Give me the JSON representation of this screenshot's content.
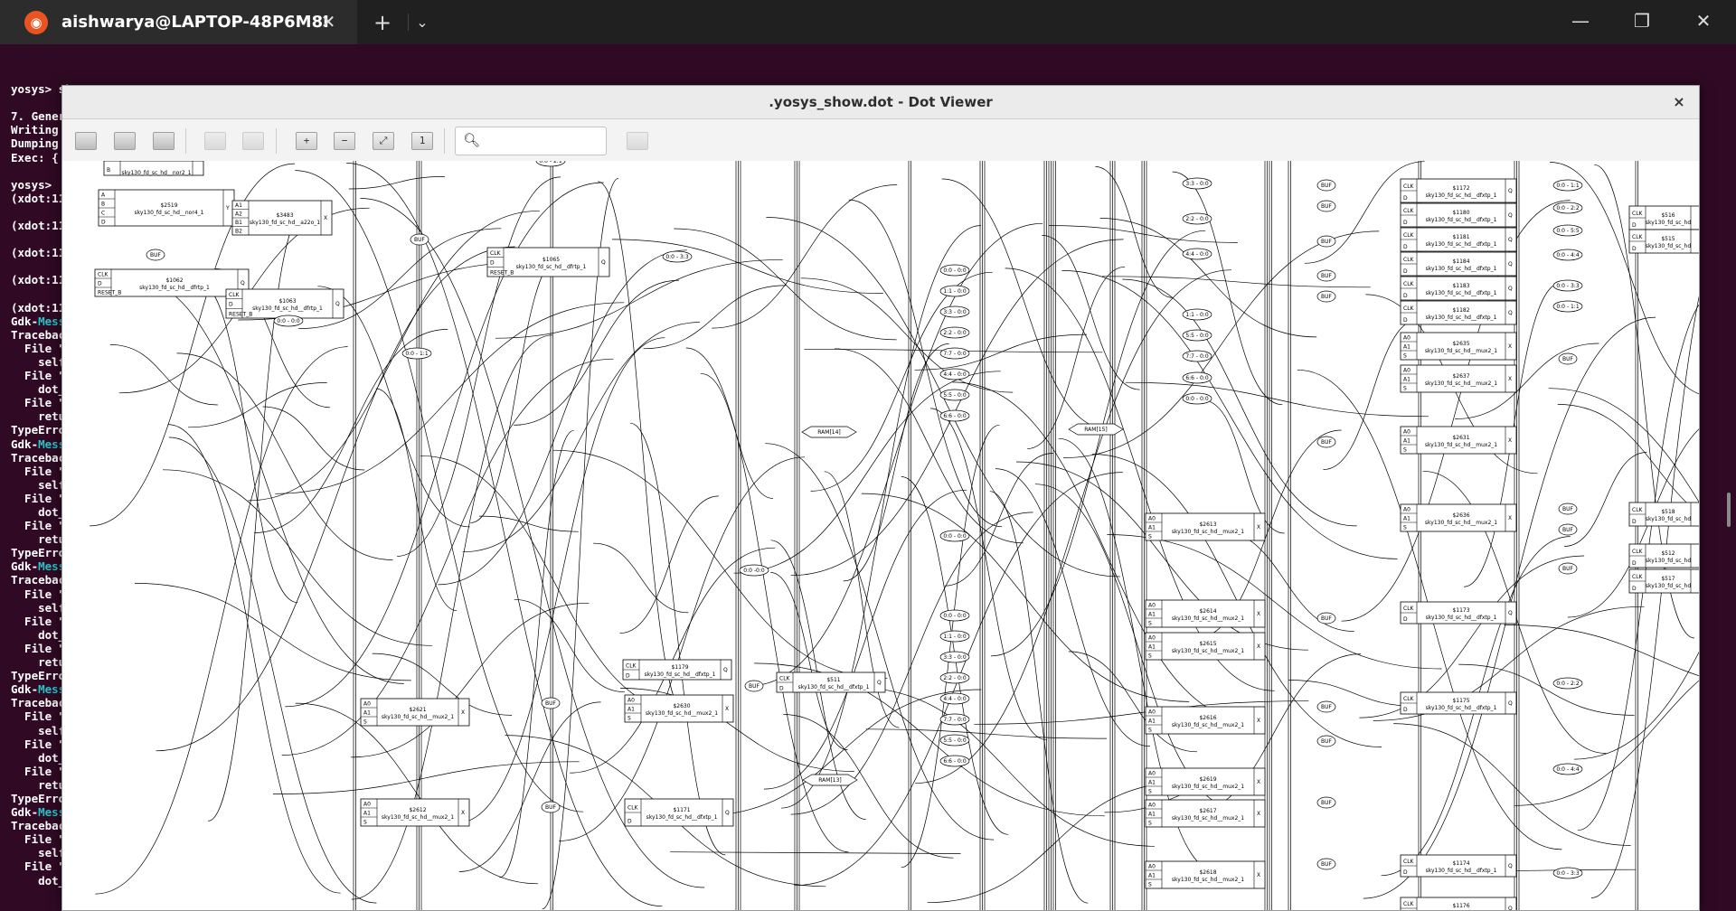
{
  "terminal_tab": {
    "title": "aishwarya@LAPTOP-48P6M8I",
    "icon": "ubuntu-icon",
    "close_glyph": "✕",
    "new_tab_glyph": "+",
    "menu_glyph": "⌄"
  },
  "window_controls": {
    "minimize": "—",
    "maximize": "❐",
    "close": "✕"
  },
  "terminal_lines": [
    {
      "text": "",
      "gdk": ""
    },
    {
      "text": "yosys> show",
      "gdk": ""
    },
    {
      "text": "",
      "gdk": ""
    },
    {
      "text": "7. Gener",
      "gdk": ""
    },
    {
      "text": "Writing ",
      "gdk": ""
    },
    {
      "text": "Dumping ",
      "gdk": ""
    },
    {
      "text": "Exec: {",
      "gdk": ""
    },
    {
      "text": "",
      "gdk": ""
    },
    {
      "text": "yosys>",
      "gdk": ""
    },
    {
      "text": "(xdot:11",
      "gdk": ""
    },
    {
      "text": "",
      "gdk": ""
    },
    {
      "text": "(xdot:11",
      "gdk": ""
    },
    {
      "text": "",
      "gdk": ""
    },
    {
      "text": "(xdot:11",
      "gdk": ""
    },
    {
      "text": "",
      "gdk": ""
    },
    {
      "text": "(xdot:11",
      "gdk": ""
    },
    {
      "text": "",
      "gdk": ""
    },
    {
      "text": "(xdot:11",
      "gdk": ""
    },
    {
      "text": "Gdk-",
      "gdk": "Mess"
    },
    {
      "text": "Tracebac",
      "gdk": ""
    },
    {
      "text": "  File \"",
      "gdk": ""
    },
    {
      "text": "    self",
      "gdk": ""
    },
    {
      "text": "  File \"",
      "gdk": ""
    },
    {
      "text": "    dot_",
      "gdk": ""
    },
    {
      "text": "  File \"",
      "gdk": ""
    },
    {
      "text": "    retu",
      "gdk": ""
    },
    {
      "text": "TypeErro",
      "gdk": ""
    },
    {
      "text": "Gdk-",
      "gdk": "Mess"
    },
    {
      "text": "Tracebac",
      "gdk": ""
    },
    {
      "text": "  File \"",
      "gdk": ""
    },
    {
      "text": "    self",
      "gdk": ""
    },
    {
      "text": "  File \"",
      "gdk": ""
    },
    {
      "text": "    dot_",
      "gdk": ""
    },
    {
      "text": "  File \"",
      "gdk": ""
    },
    {
      "text": "    retu",
      "gdk": ""
    },
    {
      "text": "TypeErro",
      "gdk": ""
    },
    {
      "text": "Gdk-",
      "gdk": "Mess"
    },
    {
      "text": "Tracebac",
      "gdk": ""
    },
    {
      "text": "  File \"",
      "gdk": ""
    },
    {
      "text": "    self",
      "gdk": ""
    },
    {
      "text": "  File \"",
      "gdk": ""
    },
    {
      "text": "    dot_",
      "gdk": ""
    },
    {
      "text": "  File \"",
      "gdk": ""
    },
    {
      "text": "    retu",
      "gdk": ""
    },
    {
      "text": "TypeErro",
      "gdk": ""
    },
    {
      "text": "Gdk-",
      "gdk": "Mess"
    },
    {
      "text": "Tracebac",
      "gdk": ""
    },
    {
      "text": "  File \"",
      "gdk": ""
    },
    {
      "text": "    self",
      "gdk": ""
    },
    {
      "text": "  File \"",
      "gdk": ""
    },
    {
      "text": "    dot_",
      "gdk": ""
    },
    {
      "text": "  File \"",
      "gdk": ""
    },
    {
      "text": "    retu",
      "gdk": ""
    },
    {
      "text": "TypeErro",
      "gdk": ""
    },
    {
      "text": "Gdk-",
      "gdk": "Mess"
    },
    {
      "text": "Tracebac",
      "gdk": ""
    },
    {
      "text": "  File \"",
      "gdk": ""
    },
    {
      "text": "    self",
      "gdk": ""
    },
    {
      "text": "  File \"",
      "gdk": ""
    },
    {
      "text": "    dot_",
      "gdk": ""
    }
  ],
  "viewer": {
    "title": ".yosys_show.dot - Dot Viewer",
    "close_glyph": "×",
    "search_icon": "search-icon",
    "search_value": ""
  },
  "graph": {
    "colors": {
      "edge": "#000000",
      "node_fill": "#ffffff"
    },
    "cells": [
      {
        "name": "cell-nor2",
        "ports_in": [
          "B"
        ],
        "id": "",
        "type": "sky130_fd_sc_hd__nor2_1",
        "out": ""
      },
      {
        "name": "cell-2519",
        "ports_in": [
          "A",
          "B",
          "C",
          "D"
        ],
        "id": "$2519",
        "type": "sky130_fd_sc_hd__nor4_1",
        "out": "Y"
      },
      {
        "name": "cell-3483",
        "ports_in": [
          "A1",
          "A2",
          "B1",
          "B2"
        ],
        "id": "$3483",
        "type": "sky130_fd_sc_hd__a22o_1",
        "out": "X"
      },
      {
        "name": "cell-1062",
        "ports_in": [
          "CLK",
          "D",
          "RESET_B"
        ],
        "id": "$1062",
        "type": "sky130_fd_sc_hd__dfrtp_1",
        "out": "Q"
      },
      {
        "name": "cell-1063",
        "ports_in": [
          "CLK",
          "D",
          "RESET_B"
        ],
        "id": "$1063",
        "type": "sky130_fd_sc_hd__dfrtp_1",
        "out": "Q"
      },
      {
        "name": "cell-1065",
        "ports_in": [
          "CLK",
          "D",
          "RESET_B"
        ],
        "id": "$1065",
        "type": "sky130_fd_sc_hd__dfrtp_1",
        "out": "Q"
      },
      {
        "name": "cell-1179",
        "ports_in": [
          "CLK",
          "D"
        ],
        "id": "$1179",
        "type": "sky130_fd_sc_hd__dfxtp_1",
        "out": "Q"
      },
      {
        "name": "cell-511",
        "ports_in": [
          "CLK",
          "D"
        ],
        "id": "$511",
        "type": "sky130_fd_sc_hd__dfxtp_1",
        "out": "Q"
      },
      {
        "name": "cell-2621",
        "ports_in": [
          "A0",
          "A1",
          "S"
        ],
        "id": "$2621",
        "type": "sky130_fd_sc_hd__mux2_1",
        "out": "X"
      },
      {
        "name": "cell-2630",
        "ports_in": [
          "A0",
          "A1",
          "S"
        ],
        "id": "$2630",
        "type": "sky130_fd_sc_hd__mux2_1",
        "out": "X"
      },
      {
        "name": "cell-2612",
        "ports_in": [
          "A0",
          "A1",
          "S"
        ],
        "id": "$2612",
        "type": "sky130_fd_sc_hd__mux2_1",
        "out": "X"
      },
      {
        "name": "cell-1171",
        "ports_in": [
          "CLK",
          "D"
        ],
        "id": "$1171",
        "type": "sky130_fd_sc_hd__dfxtp_1",
        "out": "Q"
      },
      {
        "name": "cell-2613",
        "ports_in": [
          "A0",
          "A1",
          "S"
        ],
        "id": "$2613",
        "type": "sky130_fd_sc_hd__mux2_1",
        "out": "X"
      },
      {
        "name": "cell-2614",
        "ports_in": [
          "A0",
          "A1",
          "S"
        ],
        "id": "$2614",
        "type": "sky130_fd_sc_hd__mux2_1",
        "out": "X"
      },
      {
        "name": "cell-2615",
        "ports_in": [
          "A0",
          "A1",
          "S"
        ],
        "id": "$2615",
        "type": "sky130_fd_sc_hd__mux2_1",
        "out": "X"
      },
      {
        "name": "cell-2616",
        "ports_in": [
          "A0",
          "A1",
          "S"
        ],
        "id": "$2616",
        "type": "sky130_fd_sc_hd__mux2_1",
        "out": "X"
      },
      {
        "name": "cell-2619",
        "ports_in": [
          "A0",
          "A1",
          "S"
        ],
        "id": "$2619",
        "type": "sky130_fd_sc_hd__mux2_1",
        "out": "X"
      },
      {
        "name": "cell-2617",
        "ports_in": [
          "A0",
          "A1",
          "S"
        ],
        "id": "$2617",
        "type": "sky130_fd_sc_hd__mux2_1",
        "out": "X"
      },
      {
        "name": "cell-2618",
        "ports_in": [
          "A0",
          "A1",
          "S"
        ],
        "id": "$2618",
        "type": "sky130_fd_sc_hd__mux2_1",
        "out": "X"
      },
      {
        "name": "cell-1172",
        "ports_in": [
          "CLK",
          "D"
        ],
        "id": "$1172",
        "type": "sky130_fd_sc_hd__dfxtp_1",
        "out": "Q"
      },
      {
        "name": "cell-1180",
        "ports_in": [
          "CLK",
          "D"
        ],
        "id": "$1180",
        "type": "sky130_fd_sc_hd__dfxtp_1",
        "out": "Q"
      },
      {
        "name": "cell-1181",
        "ports_in": [
          "CLK",
          "D"
        ],
        "id": "$1181",
        "type": "sky130_fd_sc_hd__dfxtp_1",
        "out": "Q"
      },
      {
        "name": "cell-1184",
        "ports_in": [
          "CLK",
          "D"
        ],
        "id": "$1184",
        "type": "sky130_fd_sc_hd__dfxtp_1",
        "out": "Q"
      },
      {
        "name": "cell-1183",
        "ports_in": [
          "CLK",
          "D"
        ],
        "id": "$1183",
        "type": "sky130_fd_sc_hd__dfxtp_1",
        "out": "Q"
      },
      {
        "name": "cell-1182",
        "ports_in": [
          "CLK",
          "D"
        ],
        "id": "$1182",
        "type": "sky130_fd_sc_hd__dfxtp_1",
        "out": "Q"
      },
      {
        "name": "cell-2635",
        "ports_in": [
          "A0",
          "A1",
          "S"
        ],
        "id": "$2635",
        "type": "sky130_fd_sc_hd__mux2_1",
        "out": "X"
      },
      {
        "name": "cell-2637",
        "ports_in": [
          "A0",
          "A1",
          "S"
        ],
        "id": "$2637",
        "type": "sky130_fd_sc_hd__mux2_1",
        "out": "X"
      },
      {
        "name": "cell-2631",
        "ports_in": [
          "A0",
          "A1",
          "S"
        ],
        "id": "$2631",
        "type": "sky130_fd_sc_hd__mux2_1",
        "out": "X"
      },
      {
        "name": "cell-2636",
        "ports_in": [
          "A0",
          "A1",
          "S"
        ],
        "id": "$2636",
        "type": "sky130_fd_sc_hd__mux2_1",
        "out": "X"
      },
      {
        "name": "cell-1173",
        "ports_in": [
          "CLK",
          "D"
        ],
        "id": "$1173",
        "type": "sky130_fd_sc_hd__dfxtp_1",
        "out": "Q"
      },
      {
        "name": "cell-1175",
        "ports_in": [
          "CLK",
          "D"
        ],
        "id": "$1175",
        "type": "sky130_fd_sc_hd__dfxtp_1",
        "out": "Q"
      },
      {
        "name": "cell-1174",
        "ports_in": [
          "CLK",
          "D"
        ],
        "id": "$1174",
        "type": "sky130_fd_sc_hd__dfxtp_1",
        "out": "Q"
      },
      {
        "name": "cell-1176",
        "ports_in": [
          "CLK",
          "D"
        ],
        "id": "$1176",
        "type": "sky130_fd_sc_hd__dfxtp_1",
        "out": "Q"
      },
      {
        "name": "cell-516",
        "ports_in": [
          "CLK",
          "D"
        ],
        "id": "$516",
        "type": "sky130_fd_sc_hd",
        "out": ""
      },
      {
        "name": "cell-515",
        "ports_in": [
          "CLK",
          "D"
        ],
        "id": "$515",
        "type": "sky130_fd_sc_hd",
        "out": ""
      },
      {
        "name": "cell-518",
        "ports_in": [
          "CLK",
          "D"
        ],
        "id": "$518",
        "type": "sky130_fd_sc_hd",
        "out": ""
      },
      {
        "name": "cell-512",
        "ports_in": [
          "CLK",
          "D"
        ],
        "id": "$512",
        "type": "sky130_fd_sc_hd",
        "out": ""
      },
      {
        "name": "cell-517",
        "ports_in": [
          "CLK",
          "D"
        ],
        "id": "$517",
        "type": "sky130_fd_sc_hd",
        "out": ""
      }
    ],
    "ellipse_labels": [
      "0:0 - 2:1",
      "0:0 - 3:3",
      "0:0 - 0:0",
      "0:0 - 1:1",
      "0:0 -0:0",
      "BUF",
      "3:3 - 0:0",
      "2:2 - 0:0",
      "4:4 - 0:0",
      "1:1 - 0:0",
      "5:5 - 0:0",
      "7:7 - 0:0",
      "6:6 - 0:0",
      "0:0 - 0:0",
      "0:0 - 2:2",
      "0:0 - 5:5",
      "0:0 - 4:4",
      "0:0 - 3:3",
      "0:0 - 1:1"
    ],
    "ram_labels": [
      "RAM[14]",
      "RAM[15]",
      "RAM[13]"
    ]
  }
}
